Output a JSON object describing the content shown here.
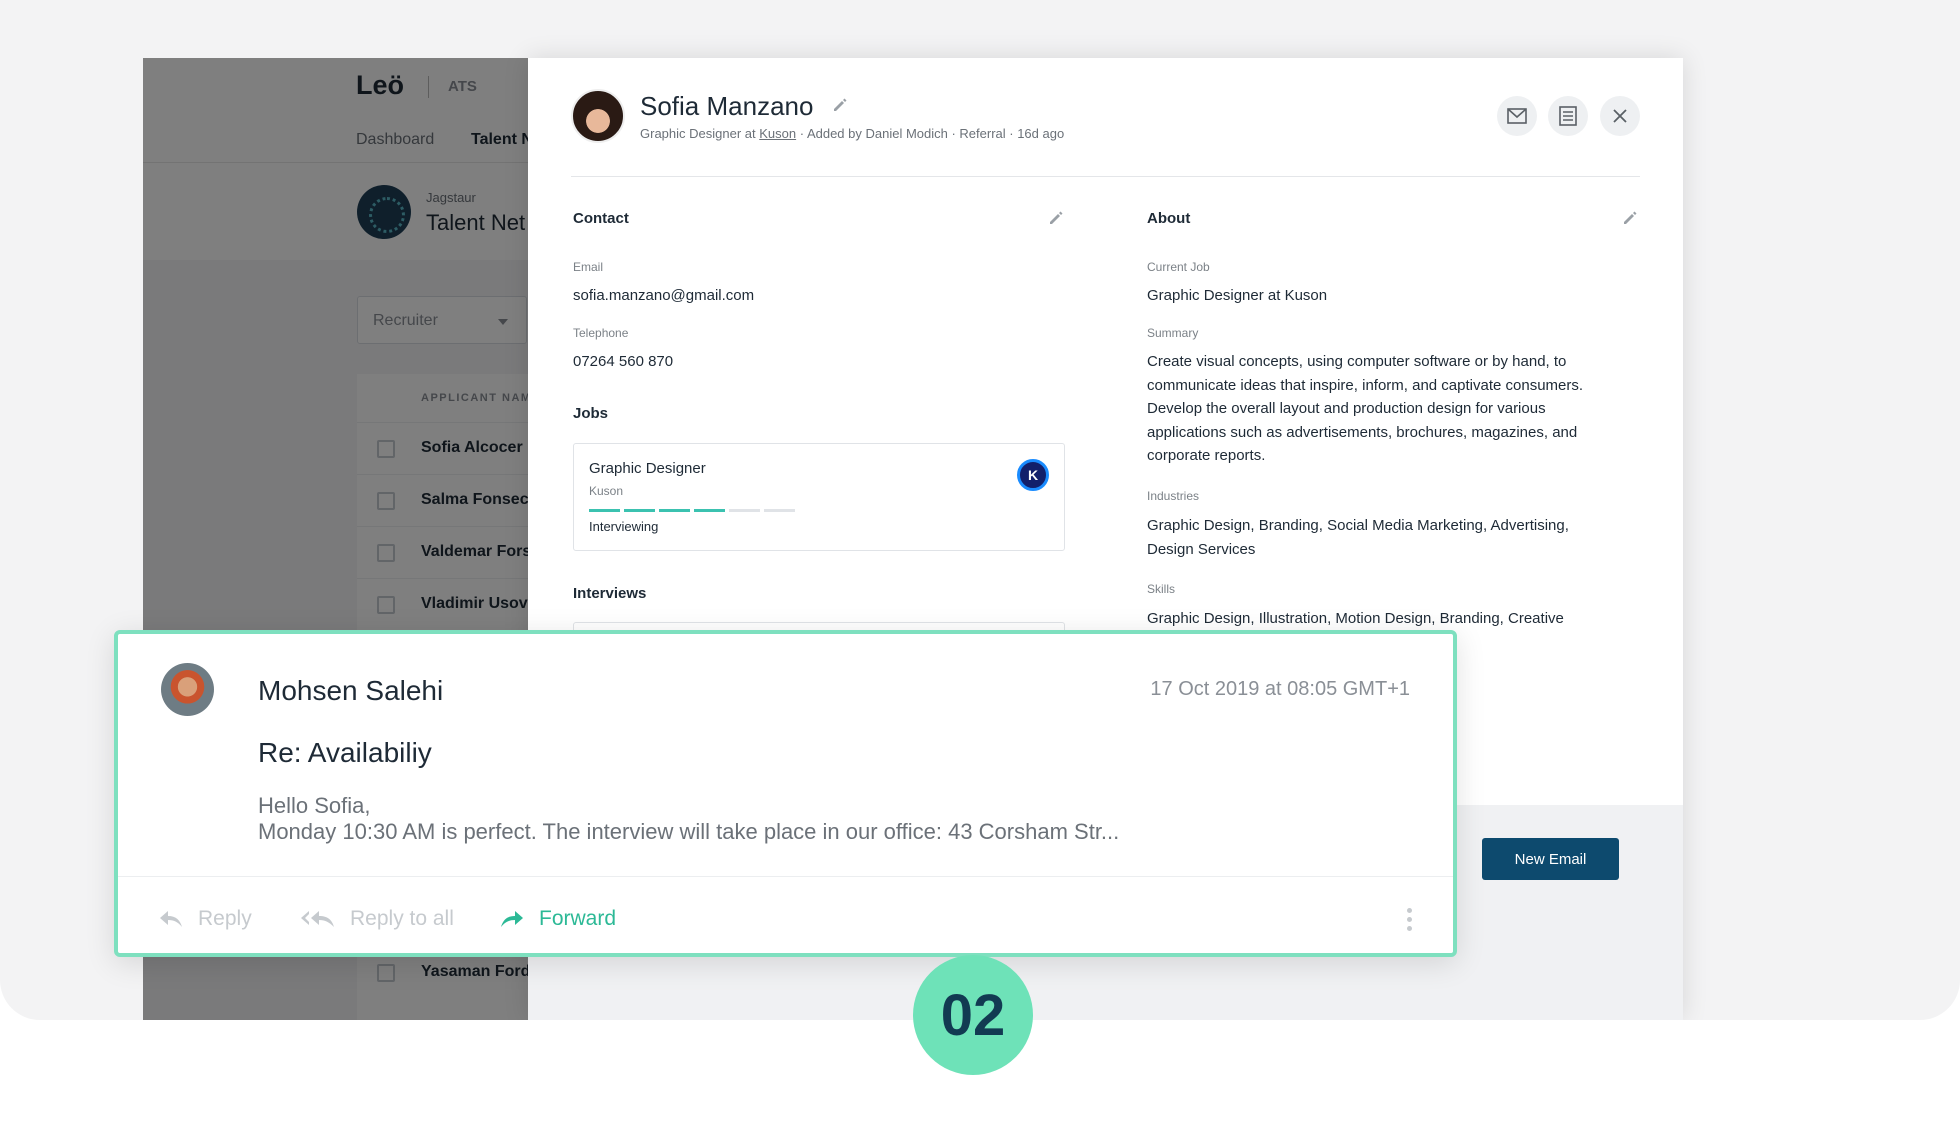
{
  "app": {
    "logo": "Leö",
    "product": "ATS",
    "nav": [
      "Dashboard",
      "Talent N"
    ],
    "org_name": "Jagstaur",
    "page_title": "Talent Net",
    "filter_placeholder": "Recruiter",
    "table_header": "APPLICANT NAM",
    "applicants": [
      "Sofia Alcocer",
      "Salma Fonsec",
      "Valdemar Fors",
      "Vladimir Usov",
      "Yasaman Ford"
    ]
  },
  "candidate": {
    "name": "Sofia Manzano",
    "subtitle_prefix": "Graphic Designer at ",
    "subtitle_company": "Kuson",
    "subtitle_suffix": " · Added by Daniel Modich · Referral · 16d ago",
    "header_buttons": [
      "mail-icon",
      "notes-icon",
      "close-icon"
    ]
  },
  "contact": {
    "title": "Contact",
    "email_label": "Email",
    "email": "sofia.manzano@gmail.com",
    "telephone_label": "Telephone",
    "telephone": "07264 560 870"
  },
  "jobs": {
    "title": "Jobs",
    "job_title": "Graphic Designer",
    "company": "Kuson",
    "company_logo_letter": "K",
    "progress_steps_total": 6,
    "progress_steps_done": 4,
    "status": "Interviewing"
  },
  "interviews": {
    "title": "Interviews"
  },
  "about": {
    "title": "About",
    "current_job_label": "Current Job",
    "current_job": "Graphic Designer at Kuson",
    "summary_label": "Summary",
    "summary_lines": [
      "Create visual concepts, using computer software or by hand, to",
      "communicate ideas that inspire, inform, and captivate consumers.",
      "Develop the overall layout and production design for various",
      "applications such as advertisements, brochures, magazines, and",
      "corporate reports."
    ],
    "industries_label": "Industries",
    "industries_lines": [
      "Graphic Design, Branding, Social Media Marketing, Advertising,",
      "Design Services"
    ],
    "skills_label": "Skills",
    "skills": "Graphic Design, Illustration, Motion Design, Branding, Creative"
  },
  "footer": {
    "new_email_label": "New Email"
  },
  "email": {
    "sender": "Mohsen Salehi",
    "date": "17 Oct 2019 at 08:05 GMT+1",
    "subject": "Re: Availabiliy",
    "preview_line1": "Hello Sofia,",
    "preview_line2": "Monday 10:30 AM is perfect. The interview will take place in our office: 43 Corsham Str...",
    "reply_label": "Reply",
    "reply_all_label": "Reply to all",
    "forward_label": "Forward"
  },
  "step_badge": "02",
  "colors": {
    "accent": "#7ee0bf",
    "forward": "#2cb996",
    "primary_button": "#0d4a6e",
    "progress": "#3bc2b0"
  }
}
